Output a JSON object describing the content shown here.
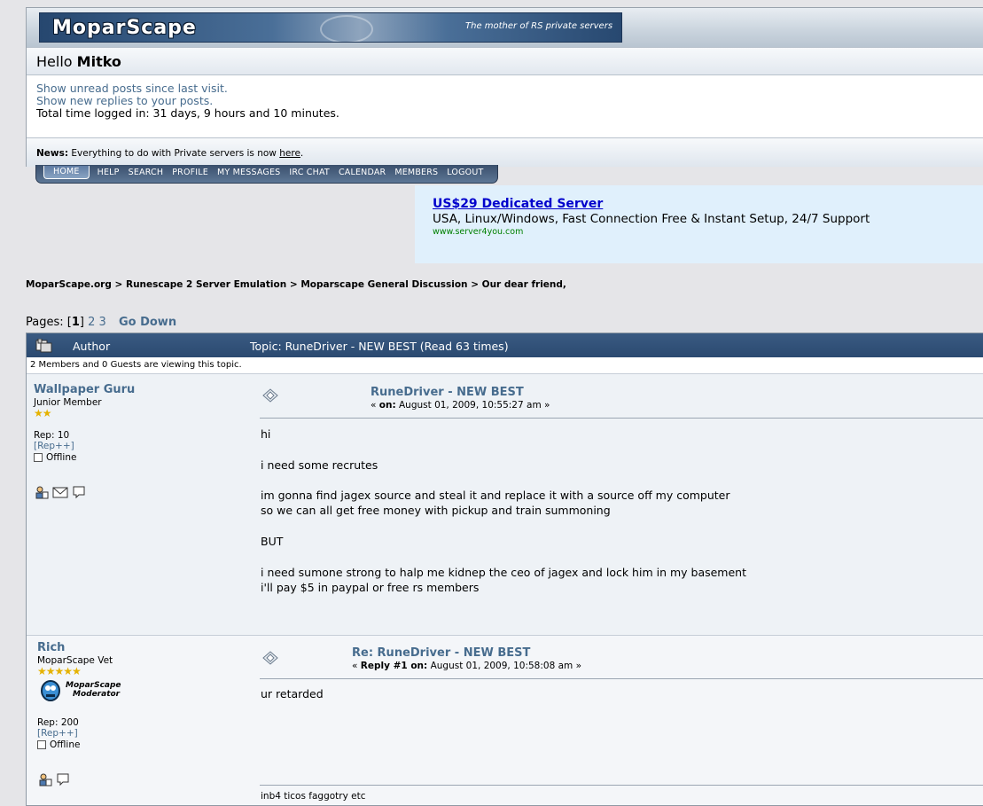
{
  "header": {
    "logo": "MoparScape",
    "tagline": "The mother of RS private servers",
    "greeting": "Hello",
    "username": "Mitko",
    "unread_link": "Show unread posts since last visit.",
    "replies_link": "Show new replies to your posts.",
    "time_logged": "Total time logged in: 31 days, 9 hours and 10 minutes.",
    "news_label": "News:",
    "news_text": "Everything to do with Private servers is now",
    "news_link": "here",
    "news_end": "."
  },
  "nav": {
    "items": [
      "HOME",
      "HELP",
      "SEARCH",
      "PROFILE",
      "MY MESSAGES",
      "IRC CHAT",
      "CALENDAR",
      "MEMBERS",
      "LOGOUT"
    ]
  },
  "ad": {
    "title": "US$29 Dedicated Server",
    "text": "USA, Linux/Windows, Fast Connection Free & Instant Setup, 24/7 Support",
    "url": "www.server4you.com"
  },
  "breadcrumb": {
    "items": [
      "MoparScape.org",
      "Runescape 2 Server Emulation",
      "Moparscape General Discussion",
      "Our dear friend,"
    ],
    "sep": ">"
  },
  "pages": {
    "label": "Pages: [",
    "current": "1",
    "close": "]",
    "p2": "2",
    "p3": "3",
    "go_down": "Go Down"
  },
  "topic": {
    "author_header": "Author",
    "title": "Topic: RuneDriver - NEW BEST  (Read 63 times)",
    "viewing": "2 Members and 0 Guests are viewing this topic."
  },
  "posts": [
    {
      "author": "Wallpaper Guru",
      "rank": "Junior Member",
      "stars": "★★",
      "rep": "Rep: 10",
      "rep_link": "[Rep++]",
      "status": "Offline",
      "title": "RuneDriver - NEW BEST",
      "date_prefix": "« ",
      "date_label": "on:",
      "date": " August 01, 2009, 10:55:27 am »",
      "body": "hi\n\ni need some recrutes\n\nim gonna find jagex source and steal it and replace it with a source off my computer\nso we can all get free money with pickup and train summoning\n\nBUT\n\ni need sumone strong to halp me kidnep the ceo of jagex and lock him in my basement\ni'll pay $5 in paypal or free rs members"
    },
    {
      "author": "Rich",
      "rank": "MoparScape Vet",
      "stars": "★★★★★",
      "badge_line1": "MoparScape",
      "badge_line2": "Moderator",
      "rep": "Rep: 200",
      "rep_link": "[Rep++]",
      "status": "Offline",
      "title": "Re: RuneDriver - NEW BEST",
      "date_prefix": "« ",
      "date_label": "Reply #1 on:",
      "date": " August 01, 2009, 10:58:08 am »",
      "body": "ur retarded",
      "signature": "inb4 ticos faggotry etc"
    }
  ]
}
